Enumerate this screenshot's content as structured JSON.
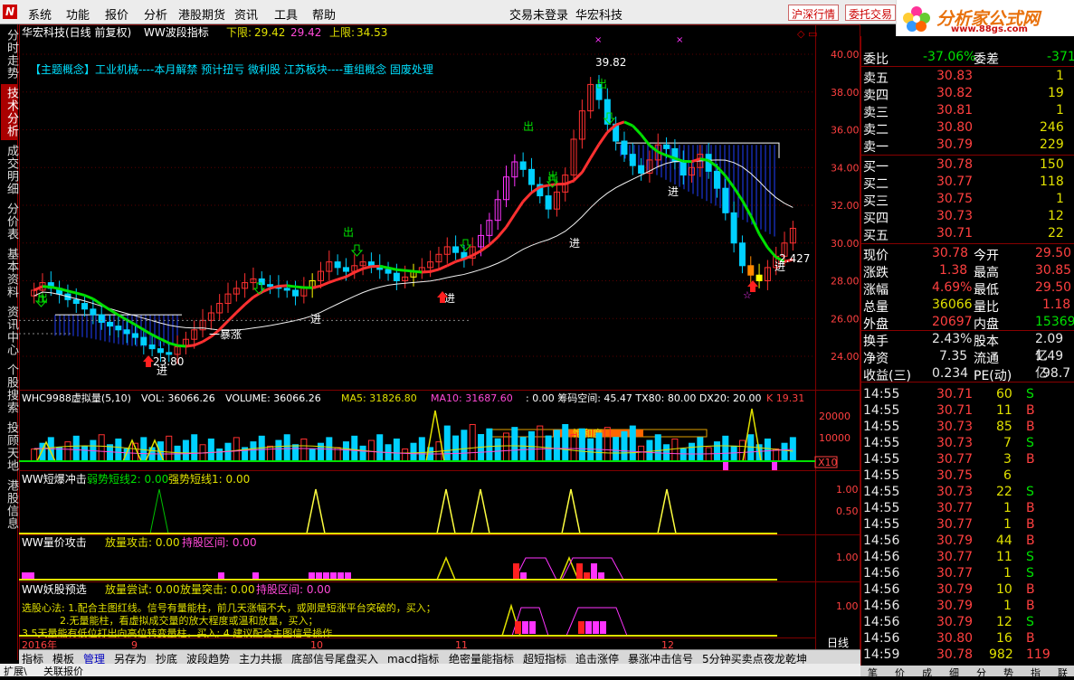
{
  "menu": {
    "items": [
      "系统",
      "功能",
      "报价",
      "分析",
      "港股期货",
      "资讯",
      "工具",
      "帮助"
    ],
    "trade_status": "交易未登录",
    "stock_name": "华宏科技",
    "btn_shsz": "沪深行情",
    "btn_order": "委托交易"
  },
  "brand": {
    "name": "分析家公式网",
    "url": "www.88gs.com"
  },
  "left_tabs": [
    "分时走势",
    "技术分析",
    "成交明细",
    "分价表",
    "基本资料",
    "资讯中心",
    "个股搜索",
    "投顾天地",
    "港股信息"
  ],
  "active_tab": 1,
  "main": {
    "title": "华宏科技(日线 前复权)",
    "indicator": "WW波段指标",
    "lower_label": "下限:",
    "lower_val1": "29.42",
    "lower_val2": "29.42",
    "upper_label": "上限:",
    "upper_val": "34.53",
    "concept": "【主题概念】工业机械----本月解禁 预计扭亏 微利股 江苏板块----重组概念 固废处理",
    "high_mark": "39.82",
    "low_mark": "23.80",
    "last_mark": "2.427",
    "chu": "出",
    "jin": "进",
    "yidiezhang": "一暴涨"
  },
  "main_axis": [
    "40.00",
    "38.00",
    "36.00",
    "34.00",
    "32.00",
    "30.00",
    "28.00",
    "26.00",
    "24.00"
  ],
  "vol_panel": {
    "title": "WHC9988虚拟量(5,10)",
    "vol": "VOL: 36066.26",
    "volume": "VOLUME: 36066.26",
    "ma5": "MA5: 31826.80",
    "ma10": "MA10: 31687.60",
    "extra": ": 0.00  筹码空间: 45.47  TX80: 80.00  DX20: 20.00",
    "k": "K 19.31",
    "axis": [
      "20000",
      "10000"
    ],
    "x10": "X10",
    "box_label": "饱和度"
  },
  "panel3": {
    "title": "WW短爆冲击",
    "l1": "弱势短线2: 0.00",
    "l2": "强势短线1: 0.00",
    "axis": [
      "1.00",
      "0.50"
    ]
  },
  "panel4": {
    "title": "WW量价攻击",
    "l1": "放量攻击: 0.00",
    "l2": "持股区间: 0.00",
    "axis": [
      "1.00"
    ]
  },
  "panel5": {
    "title": "WW妖股预选",
    "l1": "放量尝试: 0.00",
    "l2": "放量突击: 0.00",
    "l3": "持股区间: 0.00",
    "axis": [
      "1.00"
    ],
    "text1": "选股心法: 1.配合主图红线。信号有量能柱，前几天涨幅不大，或刚是短涨平台突破的，买入；",
    "text2": "2.无量能柱，看虚拟成交量的放大程度或温和放量，买入；",
    "text3": "3.5天量能有低位打出向高位转变量柱，买入; 4.建议配合主图信号操作"
  },
  "date_axis": {
    "labels": [
      "2016年",
      "9",
      "10",
      "11",
      "12"
    ],
    "period": "日线"
  },
  "quote": {
    "weibi_label": "委比",
    "weibi": "-37.06%",
    "weicha_label": "委差",
    "weicha": "-371",
    "asks": [
      {
        "l": "卖五",
        "p": "30.83",
        "v": "1"
      },
      {
        "l": "卖四",
        "p": "30.82",
        "v": "19"
      },
      {
        "l": "卖三",
        "p": "30.81",
        "v": "1"
      },
      {
        "l": "卖二",
        "p": "30.80",
        "v": "246"
      },
      {
        "l": "卖一",
        "p": "30.79",
        "v": "229"
      }
    ],
    "bids": [
      {
        "l": "买一",
        "p": "30.78",
        "v": "150"
      },
      {
        "l": "买二",
        "p": "30.77",
        "v": "118"
      },
      {
        "l": "买三",
        "p": "30.75",
        "v": "1"
      },
      {
        "l": "买四",
        "p": "30.73",
        "v": "12"
      },
      {
        "l": "买五",
        "p": "30.71",
        "v": "22"
      }
    ],
    "stats": [
      {
        "a": "现价",
        "av": "30.78",
        "b": "今开",
        "bv": "29.50",
        "ac": "red",
        "bc": "red"
      },
      {
        "a": "涨跌",
        "av": "1.38",
        "b": "最高",
        "bv": "30.85",
        "ac": "red",
        "bc": "red"
      },
      {
        "a": "涨幅",
        "av": "4.69%",
        "b": "最低",
        "bv": "29.50",
        "ac": "red",
        "bc": "red"
      },
      {
        "a": "总量",
        "av": "36066",
        "b": "量比",
        "bv": "1.18",
        "ac": "ylw",
        "bc": "red"
      },
      {
        "a": "外盘",
        "av": "20697",
        "b": "内盘",
        "bv": "15369",
        "ac": "red",
        "bc": "grn"
      },
      {
        "a": "换手",
        "av": "2.43%",
        "b": "股本",
        "bv": "2.09亿",
        "ac": "wht",
        "bc": "wht"
      },
      {
        "a": "净资",
        "av": "7.35",
        "b": "流通",
        "bv": "1.49亿",
        "ac": "wht",
        "bc": "wht"
      },
      {
        "a": "收益(三)",
        "av": "0.234",
        "b": "PE(动)",
        "bv": "98.7",
        "ac": "wht",
        "bc": "wht"
      }
    ],
    "ticks": [
      {
        "t": "14:55",
        "p": "30.71",
        "v": "60",
        "s": "S"
      },
      {
        "t": "14:55",
        "p": "30.71",
        "v": "11",
        "s": "B"
      },
      {
        "t": "14:55",
        "p": "30.73",
        "v": "85",
        "s": "B"
      },
      {
        "t": "14:55",
        "p": "30.73",
        "v": "7",
        "s": "S"
      },
      {
        "t": "14:55",
        "p": "30.77",
        "v": "3",
        "s": "B"
      },
      {
        "t": "14:55",
        "p": "30.75",
        "v": "6",
        "s": ""
      },
      {
        "t": "14:55",
        "p": "30.73",
        "v": "22",
        "s": "S"
      },
      {
        "t": "14:55",
        "p": "30.77",
        "v": "1",
        "s": "B"
      },
      {
        "t": "14:55",
        "p": "30.77",
        "v": "1",
        "s": "B"
      },
      {
        "t": "14:56",
        "p": "30.79",
        "v": "44",
        "s": "B"
      },
      {
        "t": "14:56",
        "p": "30.77",
        "v": "11",
        "s": "S"
      },
      {
        "t": "14:56",
        "p": "30.77",
        "v": "1",
        "s": "S"
      },
      {
        "t": "14:56",
        "p": "30.79",
        "v": "10",
        "s": "B"
      },
      {
        "t": "14:56",
        "p": "30.79",
        "v": "1",
        "s": "B"
      },
      {
        "t": "14:56",
        "p": "30.79",
        "v": "12",
        "s": "S"
      },
      {
        "t": "14:56",
        "p": "30.80",
        "v": "16",
        "s": "B"
      },
      {
        "t": "14:59",
        "p": "30.78",
        "v": "982",
        "s": "119"
      }
    ],
    "bottom_tabs": [
      "笔",
      "价",
      "成",
      "细",
      "分",
      "势",
      "指",
      "联"
    ]
  },
  "bottom_tabs": [
    "指标",
    "模板",
    "管理",
    "另存为",
    "抄底",
    "波段趋势",
    "主力共振",
    "底部信号尾盘买入",
    "macd指标",
    "绝密量能指标",
    "超短指标",
    "追击涨停",
    "暴涨冲击信号",
    "5分钟买卖点",
    "夜龙乾坤"
  ],
  "status": {
    "left": "扩展\\",
    "right": "关联报价"
  }
}
